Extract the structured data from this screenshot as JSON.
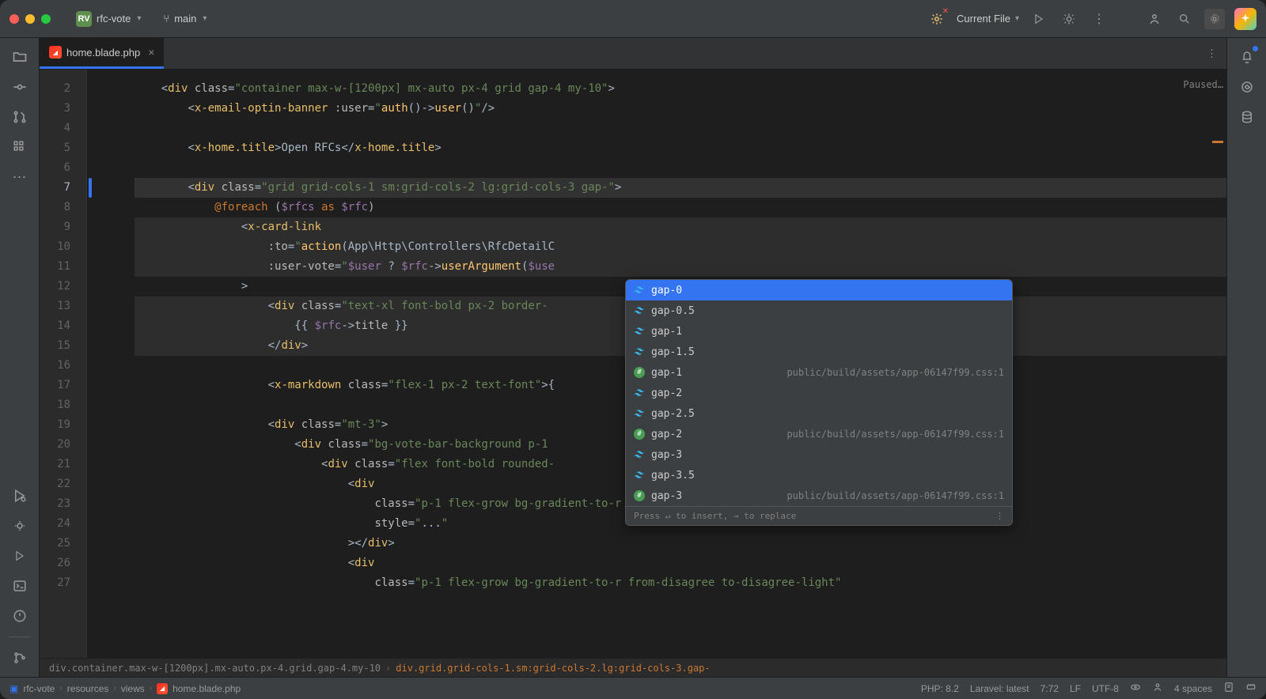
{
  "titlebar": {
    "project_name": "rfc-vote",
    "project_initials": "RV",
    "branch_icon": "⎇",
    "branch_name": "main",
    "run_config": "Current File"
  },
  "tabs": {
    "active": {
      "name": "home.blade.php"
    }
  },
  "gutter": {
    "start": 2,
    "end": 27,
    "current": 7
  },
  "code": {
    "lines": [
      {
        "n": 2,
        "indent": "    ",
        "html": "<span class='op'>&lt;</span><span class='tag'>div </span><span class='attr'>class</span><span class='op'>=</span><span class='str'>\"container max-w-[1200px] mx-auto px-4 grid gap-4 my-10\"</span><span class='op'>&gt;</span>"
      },
      {
        "n": 3,
        "indent": "        ",
        "html": "<span class='op'>&lt;</span><span class='tag'>x-email-optin-banner </span><span class='attr'>:user</span><span class='op'>=</span><span class='str'>\"</span><span class='fn'>auth</span><span class='op'>()-&gt;</span><span class='fn'>user</span><span class='op'>()</span><span class='str'>\"</span><span class='op'>/&gt;</span>"
      },
      {
        "n": 4,
        "indent": "",
        "html": ""
      },
      {
        "n": 5,
        "indent": "        ",
        "html": "<span class='op'>&lt;</span><span class='tag'>x-home.title</span><span class='op'>&gt;</span>Open RFCs<span class='op'>&lt;/</span><span class='tag'>x-home.title</span><span class='op'>&gt;</span>"
      },
      {
        "n": 6,
        "indent": "",
        "html": ""
      },
      {
        "n": 7,
        "indent": "        ",
        "html": "<span class='op'>&lt;</span><span class='tag'>div </span><span class='attr'>class</span><span class='op'>=</span><span class='str'>\"grid grid-cols-1 sm:grid-cols-2 lg:grid-cols-3 gap-\"</span><span class='op'>&gt;</span>",
        "current": true
      },
      {
        "n": 8,
        "indent": "            ",
        "html": "<span class='directive'>@foreach</span> <span class='op'>(</span><span class='var'>$rfcs</span> <span class='kw'>as</span> <span class='var'>$rfc</span><span class='op'>)</span>"
      },
      {
        "n": 9,
        "indent": "                ",
        "html": "<span class='op'>&lt;</span><span class='tag'>x-card-link</span>",
        "bg": true
      },
      {
        "n": 10,
        "indent": "                    ",
        "html": "<span class='attr'>:to</span><span class='op'>=</span><span class='str'>\"</span><span class='fn'>action</span><span class='op'>(App\\Http\\Controllers\\RfcDetailC</span>",
        "bg": true
      },
      {
        "n": 11,
        "indent": "                    ",
        "html": "<span class='attr'>:user-vote</span><span class='op'>=</span><span class='str'>\"</span><span class='var'>$user</span> <span class='op'>?</span> <span class='var'>$rfc</span><span class='op'>-&gt;</span><span class='fn'>userArgument</span><span class='op'>(</span><span class='var'>$use</span>",
        "bg": true
      },
      {
        "n": 12,
        "indent": "                ",
        "html": "<span class='op'>&gt;</span>"
      },
      {
        "n": 13,
        "indent": "                    ",
        "html": "<span class='op'>&lt;</span><span class='tag'>div </span><span class='attr'>class</span><span class='op'>=</span><span class='str'>\"text-xl font-bold px-2 border-</span>",
        "bg": true
      },
      {
        "n": 14,
        "indent": "                        ",
        "html": "<span class='op'>{{ </span><span class='var'>$rfc</span><span class='op'>-&gt;</span><span class='attr'>title</span><span class='op'> }}</span>",
        "bg": true
      },
      {
        "n": 15,
        "indent": "                    ",
        "html": "<span class='op'>&lt;/</span><span class='tag'>div</span><span class='op'>&gt;</span>",
        "bg": true
      },
      {
        "n": 16,
        "indent": "",
        "html": ""
      },
      {
        "n": 17,
        "indent": "                    ",
        "html": "<span class='op'>&lt;</span><span class='tag'>x-markdown </span><span class='attr'>class</span><span class='op'>=</span><span class='str'>\"flex-1 px-2 text-font\"</span><span class='op'>&gt;{</span>"
      },
      {
        "n": 18,
        "indent": "",
        "html": ""
      },
      {
        "n": 19,
        "indent": "                    ",
        "html": "<span class='op'>&lt;</span><span class='tag'>div </span><span class='attr'>class</span><span class='op'>=</span><span class='str'>\"mt-3\"</span><span class='op'>&gt;</span>"
      },
      {
        "n": 20,
        "indent": "                        ",
        "html": "<span class='op'>&lt;</span><span class='tag'>div </span><span class='attr'>class</span><span class='op'>=</span><span class='str'>\"bg-vote-bar-background p-1</span>"
      },
      {
        "n": 21,
        "indent": "                            ",
        "html": "<span class='op'>&lt;</span><span class='tag'>div </span><span class='attr'>class</span><span class='op'>=</span><span class='str'>\"flex font-bold rounded-</span>"
      },
      {
        "n": 22,
        "indent": "                                ",
        "html": "<span class='op'>&lt;</span><span class='tag'>div</span>"
      },
      {
        "n": 23,
        "indent": "                                    ",
        "html": "<span class='attr'>class</span><span class='op'>=</span><span class='str'>\"p-1 flex-grow bg-gradient-to-r from-agree to-agree-light\"</span>"
      },
      {
        "n": 24,
        "indent": "                                    ",
        "html": "<span class='attr'>style</span><span class='op'>=</span><span class='str'>\"</span><span class='op'>...</span><span class='str'>\"</span>"
      },
      {
        "n": 25,
        "indent": "                                ",
        "html": "<span class='op'>&gt;&lt;/</span><span class='tag'>div</span><span class='op'>&gt;</span>"
      },
      {
        "n": 26,
        "indent": "                                ",
        "html": "<span class='op'>&lt;</span><span class='tag'>div</span>"
      },
      {
        "n": 27,
        "indent": "                                    ",
        "html": "<span class='attr'>class</span><span class='op'>=</span><span class='str'>\"p-1 flex-grow bg-gradient-to-r from-disagree to-disagree-light\"</span>"
      }
    ]
  },
  "autocomplete": {
    "items": [
      {
        "icon": "tw",
        "label": "gap-0",
        "selected": true
      },
      {
        "icon": "tw",
        "label": "gap-0.5"
      },
      {
        "icon": "tw",
        "label": "gap-1"
      },
      {
        "icon": "tw",
        "label": "gap-1.5"
      },
      {
        "icon": "css",
        "label": "gap-1",
        "hint": "public/build/assets/app-06147f99.css:1"
      },
      {
        "icon": "tw",
        "label": "gap-2"
      },
      {
        "icon": "tw",
        "label": "gap-2.5"
      },
      {
        "icon": "css",
        "label": "gap-2",
        "hint": "public/build/assets/app-06147f99.css:1"
      },
      {
        "icon": "tw",
        "label": "gap-3"
      },
      {
        "icon": "tw",
        "label": "gap-3.5"
      },
      {
        "icon": "css",
        "label": "gap-3",
        "hint": "public/build/assets/app-06147f99.css:1"
      }
    ],
    "footer_text": "Press ↵ to insert, → to replace"
  },
  "code_breadcrumb": {
    "path": "div.container.max-w-[1200px].mx-auto.px-4.grid.gap-4.my-10",
    "current": "div.grid.grid-cols-1.sm:grid-cols-2.lg:grid-cols-3.gap-"
  },
  "status": {
    "project": "rfc-vote",
    "path_parts": [
      "resources",
      "views",
      "home.blade.php"
    ],
    "php": "PHP: 8.2",
    "laravel": "Laravel: latest",
    "pos": "7:72",
    "line_sep": "LF",
    "encoding": "UTF-8",
    "indent": "4 spaces"
  },
  "right_panel": {
    "paused": "Paused…"
  }
}
